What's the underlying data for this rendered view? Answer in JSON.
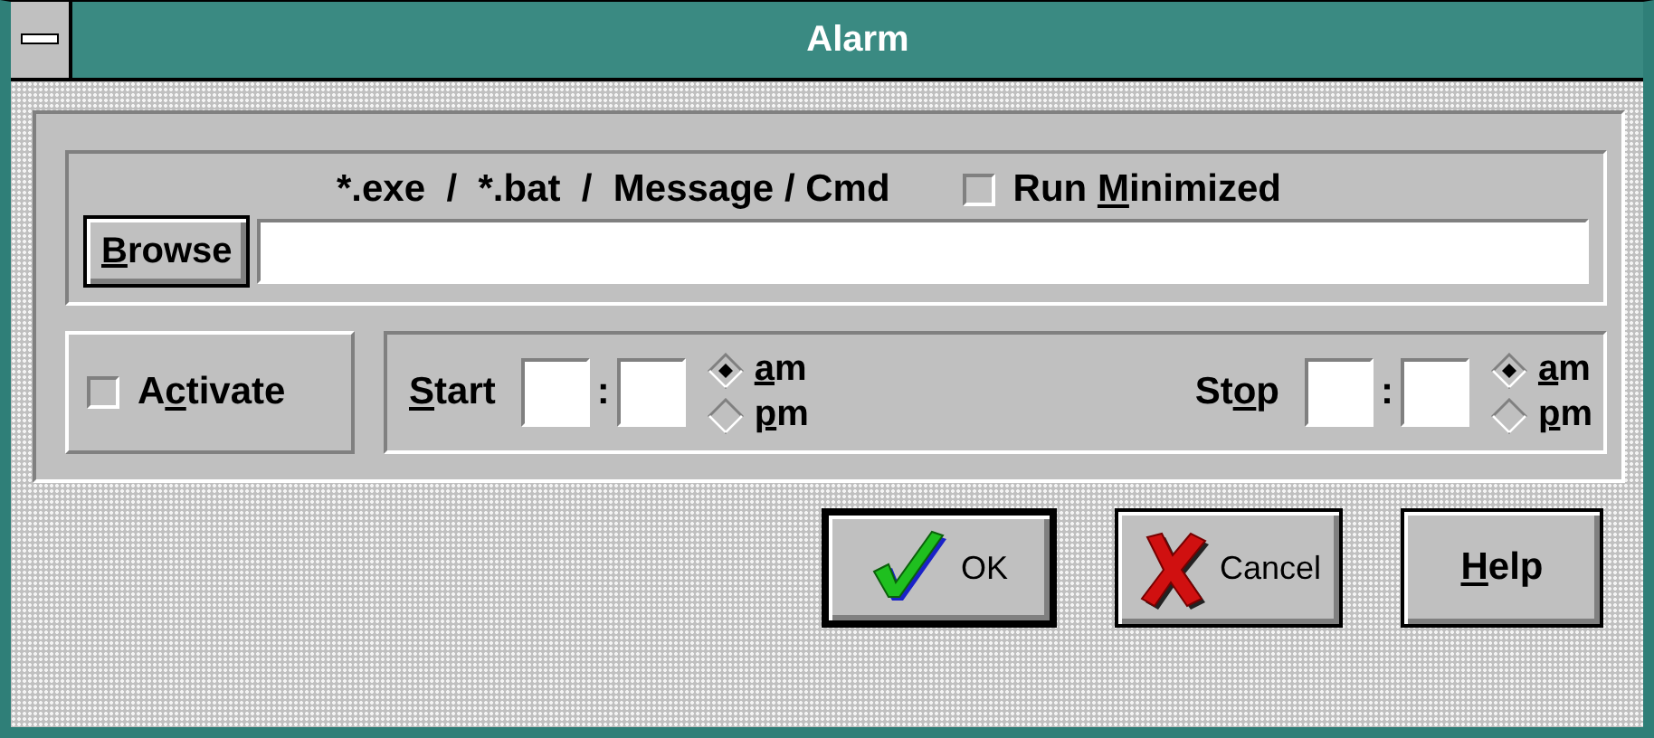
{
  "window": {
    "title": "Alarm"
  },
  "command": {
    "caption": "*.exe  /  *.bat  /  Message / Cmd",
    "browse_button": {
      "label_key": "B",
      "label_post": "rowse"
    },
    "run_minimized": {
      "label_pre": "Run ",
      "label_key": "M",
      "label_post": "inimized",
      "checked": false
    }
  },
  "activate": {
    "label_pre": "A",
    "label_key": "c",
    "label_post": "tivate",
    "checked": false
  },
  "times": [
    {
      "label_key": "S",
      "label_post": "tart",
      "separator": ":",
      "period": [
        {
          "label_key": "a",
          "label_post": "m",
          "selected": true
        },
        {
          "label_key": "p",
          "label_post": "m",
          "selected": false
        }
      ]
    },
    {
      "label_pre": "St",
      "label_key": "o",
      "label_post": "p",
      "separator": ":",
      "period": [
        {
          "label_key": "a",
          "label_post": "m",
          "selected": true
        },
        {
          "label_key": "p",
          "label_post": "m",
          "selected": false
        }
      ]
    }
  ],
  "buttons": [
    {
      "kind": "ok",
      "label_pre": "OK",
      "default": true
    },
    {
      "kind": "cancel",
      "label_pre": "Cancel",
      "default": false
    },
    {
      "kind": "help",
      "label_key": "H",
      "label_post": "elp",
      "default": false
    }
  ]
}
